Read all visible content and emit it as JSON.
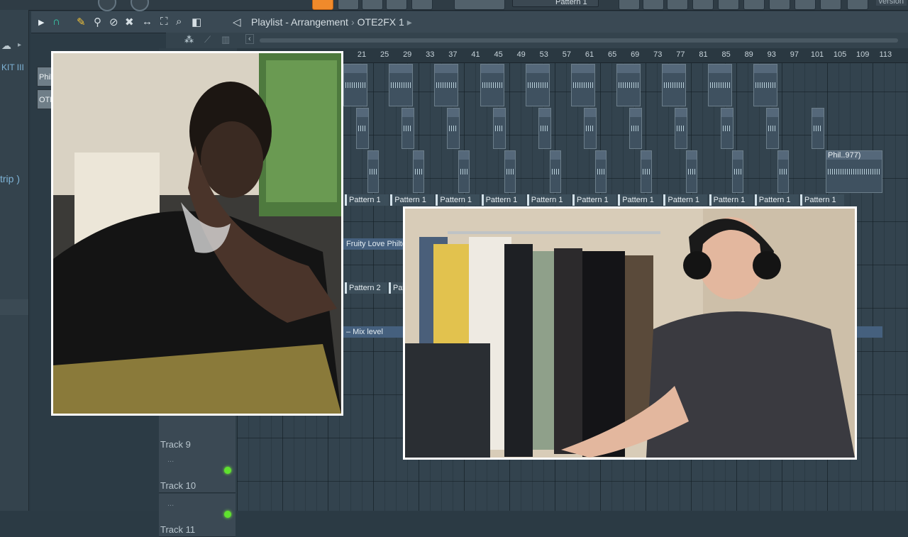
{
  "top": {
    "version_label": "version",
    "pattern_label": "Pattern 1"
  },
  "browser": {
    "cloud_icon": "☁",
    "arrow": "▸",
    "kit_label": "KIT III",
    "strip_label": "trip )"
  },
  "playlist": {
    "breadcrumb": {
      "title": "Playlist - Arrangement",
      "separator": "›",
      "pattern": "OTE2FX 1",
      "end_arrow": "▸"
    },
    "channels": [
      "Phil",
      "OTE"
    ],
    "ruler_ticks": [
      "21",
      "25",
      "29",
      "33",
      "37",
      "41",
      "45",
      "49",
      "53",
      "57",
      "61",
      "65",
      "69",
      "73",
      "77",
      "81",
      "85",
      "89",
      "93",
      "97",
      "101",
      "105",
      "109",
      "113"
    ],
    "tracks": [
      {
        "name": "Track 9",
        "dots": "...",
        "led": true
      },
      {
        "name": "Track 10",
        "dots": "...",
        "led": true
      },
      {
        "name": "Track 11",
        "dots": "...",
        "led": true
      }
    ],
    "pattern_clips": [
      "Pattern 1",
      "Pattern 1",
      "Pattern 1",
      "Pattern 1",
      "Pattern 1",
      "Pattern 1",
      "Pattern 1",
      "Pattern 1",
      "Pattern 1",
      "Pattern 1",
      "Pattern 1"
    ],
    "pattern2_clip": "Pattern 2",
    "pattern2_partial": "Pat",
    "fruity_clip": "Fruity Love Philte",
    "mix_level": "Mix level",
    "phil_clip": "Phil..977)"
  }
}
